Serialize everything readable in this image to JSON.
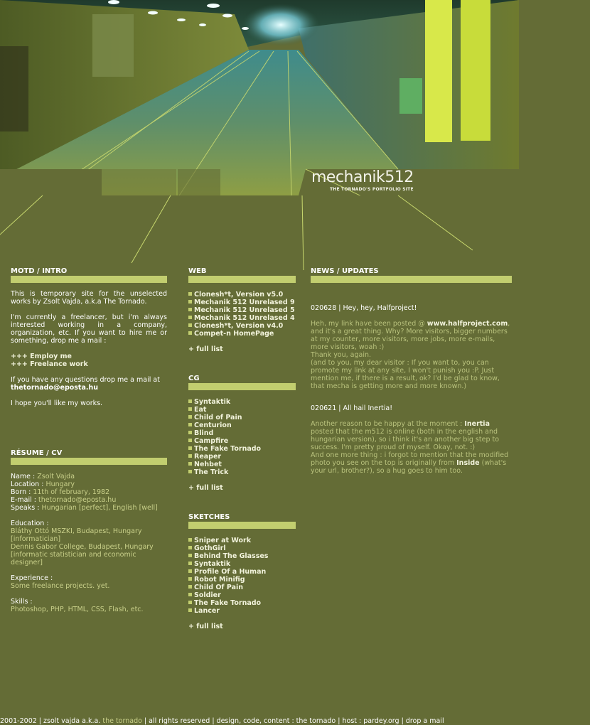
{
  "header": {
    "logo_text": "mechanik512",
    "logo_tagline": "THE TORNADO'S PORTFOLIO SITE"
  },
  "motd": {
    "title": "MOTD / INTRO",
    "p1": "This is temporary site for the unselected works by Zsolt Vajda, a.k.a The Tornado.",
    "p2": "I'm currently a freelancer, but i'm always interested working in a company, organization, etc. If you want to hire me or something, drop me a mail :",
    "employ": "+++ Employ me",
    "freelance": "+++ Freelance work",
    "p3": "If you have any questions drop me a mail at",
    "email": "thetornado@eposta.hu",
    "p4": "I hope you'll like my works."
  },
  "resume": {
    "title": "RÉSUME / CV",
    "name_label": "Name :",
    "name": "Zsolt Vajda",
    "location_label": "Location :",
    "location": "Hungary",
    "born_label": "Born :",
    "born": "11th of february, 1982",
    "email_label": "E-mail :",
    "email": "thetornado@eposta.hu",
    "speaks_label": "Speaks :",
    "speaks": "Hungarian [perfect], English [well]",
    "education_label": "Education :",
    "edu1": "Bláthy Ottó MSZKI, Budapest, Hungary",
    "edu1b": "[informatician]",
    "edu2": "Dennis Gabor College, Budapest, Hungary",
    "edu2b": "[informatic statistician and economic designer]",
    "experience_label": "Experience :",
    "experience": "Some freelance projects. yet.",
    "skills_label": "Skills :",
    "skills": "Photoshop, PHP, HTML, CSS, Flash, etc."
  },
  "web": {
    "title": "WEB",
    "items": [
      "Clonesh*t, Version v5.0",
      "Mechanik 512 Unrelased 9",
      "Mechanik 512 Unrelased 5",
      "Mechanik 512 Unrelased 4",
      "Clonesh*t, Version v4.0",
      "Compet-n HomePage"
    ],
    "full_list": "+ full list"
  },
  "cg": {
    "title": "CG",
    "items": [
      "Syntaktik",
      "Eat",
      "Child of Pain",
      "Centurion",
      "Blind",
      "Campfire",
      "The Fake Tornado",
      "Reaper",
      "Nehbet",
      "The Trick"
    ],
    "full_list": "+ full list"
  },
  "sketches": {
    "title": "SKETCHES",
    "items": [
      "Sniper at Work",
      "GothGirl",
      "Behind The Glasses",
      "Syntaktik",
      "Profile Of a Human",
      "Robot Minifig",
      "Child Of Pain",
      "Soldier",
      "The Fake Tornado",
      "Lancer"
    ],
    "full_list": "+ full list"
  },
  "news": {
    "title": "NEWS / UPDATES",
    "n1_head": "020628 | Hey, hey, Halfproject!",
    "n1_a": "Heh, my link have been posted @ ",
    "n1_link": "www.halfproject.com",
    "n1_b": ", and it's a great thing. Why? More visitors, bigger numbers at my counter, more visitors, more jobs, more e-mails, more visitors, woah :)",
    "n1_c": "Thank you, again.",
    "n1_d": "(and to you, my dear visitor : If you want to, you can promote my link at any site, I won't punish you :P. Just mention me, if there is a result, ok? I'd be glad to know, that mecha is getting more and more known.)",
    "n2_head": "020621 | All hail Inertia!",
    "n2_a": "Another reason to be happy at the moment : ",
    "n2_inertia": "Inertia",
    "n2_b": " posted that the m512 is online (both in the english and hungarian version), so i think it's an another big step to success. I'm pretty proud of myself. Okay, not. :)",
    "n2_c": "And one more thing : i forgot to mention that the modified photo you see on the top is originally from ",
    "n2_inside": "Inside",
    "n2_d": " (what's your url, brother?), so a hug goes to him too."
  },
  "footer": {
    "a": "2001-2002 | zsolt vajda a.k.a. ",
    "tornado": "the tornado",
    "b": " | all rights reserved | design, code, content : the tornado | host : pardey.org | drop a mail"
  },
  "colors": {
    "background": "#646c36",
    "accent_bar": "#c2ce6f",
    "text_light": "#c9d08a"
  },
  "header_image": "tunnel-photo"
}
